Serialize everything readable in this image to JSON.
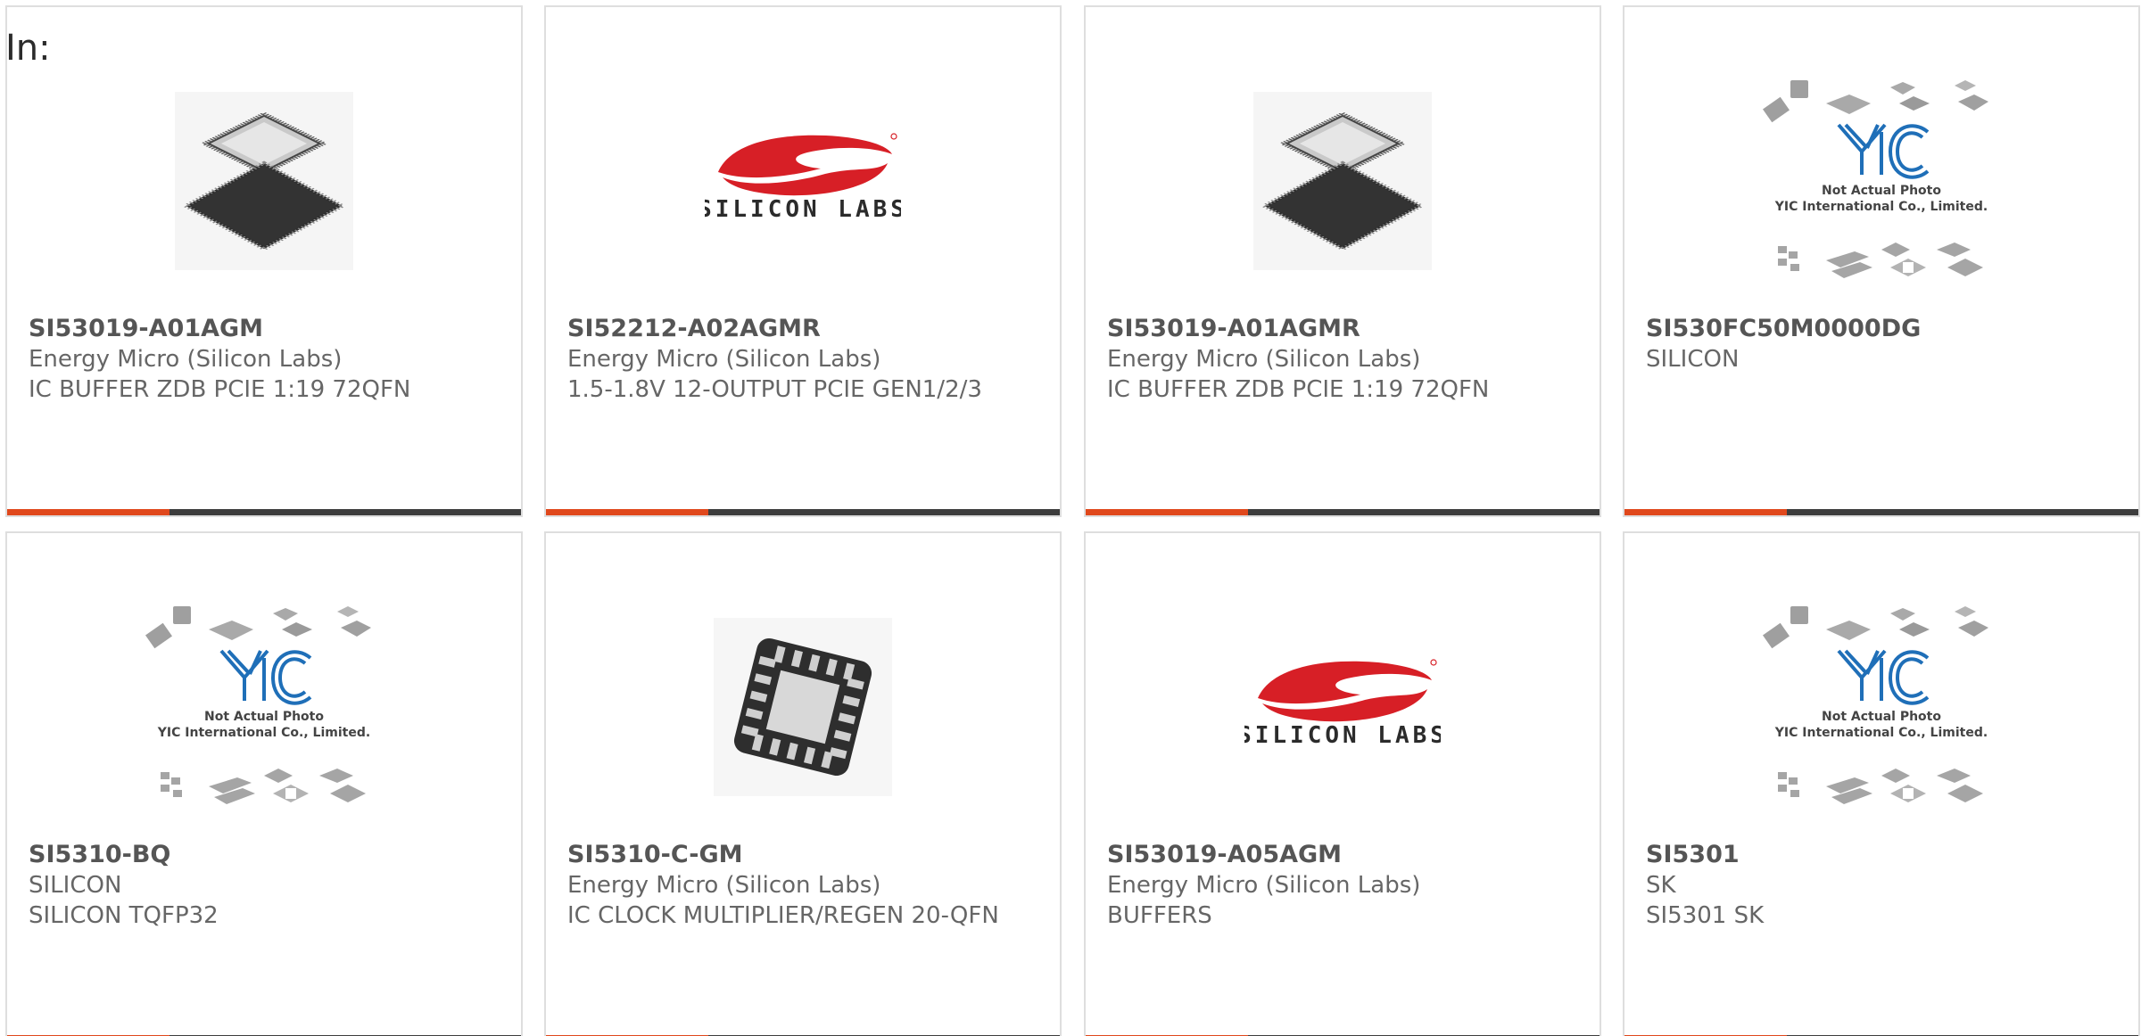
{
  "header": {
    "in_label": "In:"
  },
  "colors": {
    "accent": "#e0481c",
    "bar_dark": "#3d3d3d",
    "silicon_labs_red": "#d71f26",
    "yic_blue": "#1f6fb8"
  },
  "placeholder_image": {
    "line1": "Not Actual Photo",
    "line2": "YIC International Co., Limited."
  },
  "logo": {
    "silicon_labs": "SILICON LABS"
  },
  "products": [
    {
      "part_number": "SI53019-A01AGM",
      "manufacturer": "Energy Micro (Silicon Labs)",
      "description": "IC BUFFER ZDB PCIE 1:19 72QFN",
      "image": "qfn-chip-photo"
    },
    {
      "part_number": "SI52212-A02AGMR",
      "manufacturer": "Energy Micro (Silicon Labs)",
      "description": "1.5-1.8V 12-OUTPUT PCIE GEN1/2/3",
      "image": "silicon-labs-logo"
    },
    {
      "part_number": "SI53019-A01AGMR",
      "manufacturer": "Energy Micro (Silicon Labs)",
      "description": "IC BUFFER ZDB PCIE 1:19 72QFN",
      "image": "qfn-chip-photo"
    },
    {
      "part_number": "SI530FC50M0000DG",
      "manufacturer": "SILICON",
      "description": "",
      "image": "yic-placeholder"
    },
    {
      "part_number": "SI5310-BQ",
      "manufacturer": "SILICON",
      "description": "SILICON TQFP32",
      "image": "yic-placeholder"
    },
    {
      "part_number": "SI5310-C-GM",
      "manufacturer": "Energy Micro (Silicon Labs)",
      "description": "IC CLOCK MULTIPLIER/REGEN 20-QFN",
      "image": "qfn20-chip-photo"
    },
    {
      "part_number": "SI53019-A05AGM",
      "manufacturer": "Energy Micro (Silicon Labs)",
      "description": "BUFFERS",
      "image": "silicon-labs-logo"
    },
    {
      "part_number": "SI5301",
      "manufacturer": "SK",
      "description": "SI5301 SK",
      "image": "yic-placeholder"
    }
  ]
}
